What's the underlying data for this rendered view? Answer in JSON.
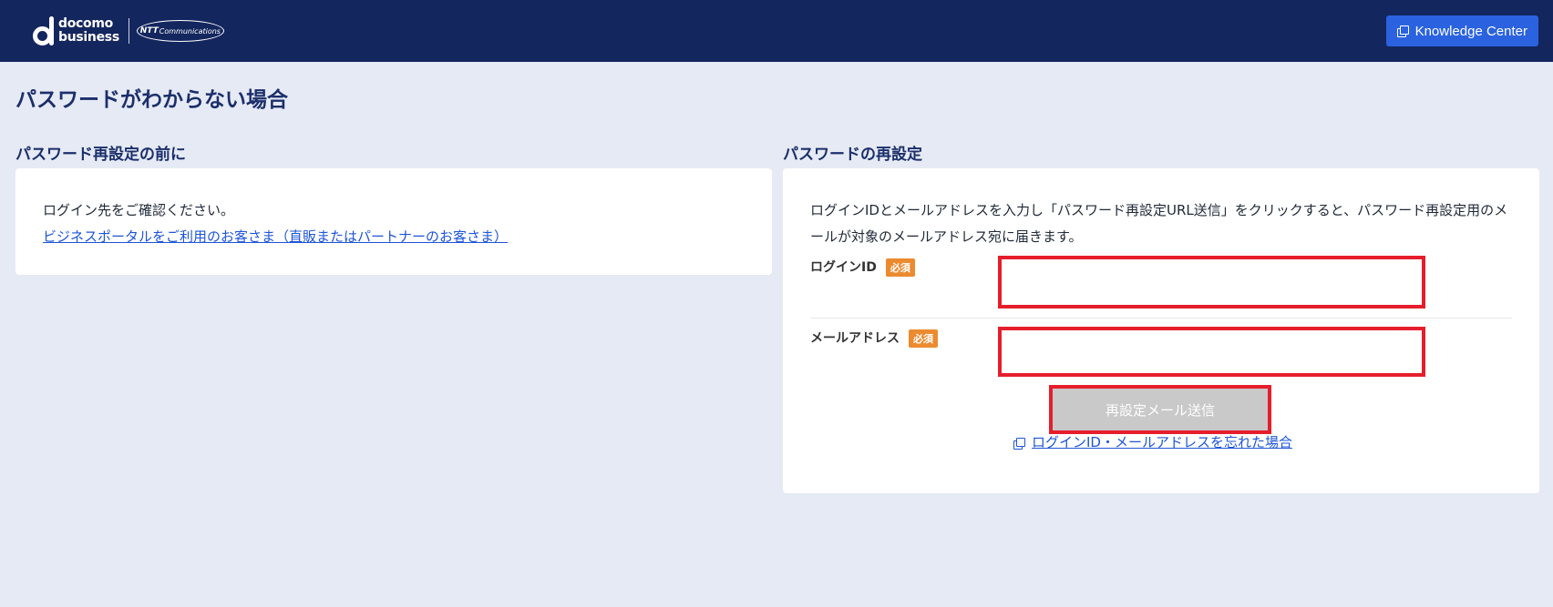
{
  "header": {
    "logo": {
      "line1": "docomo",
      "line2": "business",
      "partner_bold": "NTT",
      "partner_rest": "Communications"
    },
    "knowledge_center_label": "Knowledge Center"
  },
  "page_title": "パスワードがわからない場合",
  "left": {
    "section_title": "パスワード再設定の前に",
    "message": "ログイン先をご確認ください。",
    "portal_link": "ビジネスポータルをご利用のお客さま（直販またはパートナーのお客さま）"
  },
  "right": {
    "section_title": "パスワードの再設定",
    "instructions": "ログインIDとメールアドレスを入力し「パスワード再設定URL送信」をクリックすると、パスワード再設定用のメールが対象のメールアドレス宛に届きます。",
    "login_id_label": "ログインID",
    "email_label": "メールアドレス",
    "required_badge": "必須",
    "login_id_value": "",
    "email_value": "",
    "submit_label": "再設定メール送信",
    "forgot_link": "ログインID・メールアドレスを忘れた場合"
  },
  "colors": {
    "header_bg": "#14265e",
    "accent": "#2a62e0",
    "page_bg": "#e6eaf4",
    "required": "#ec8a2f",
    "highlight": "#e61e2b"
  }
}
